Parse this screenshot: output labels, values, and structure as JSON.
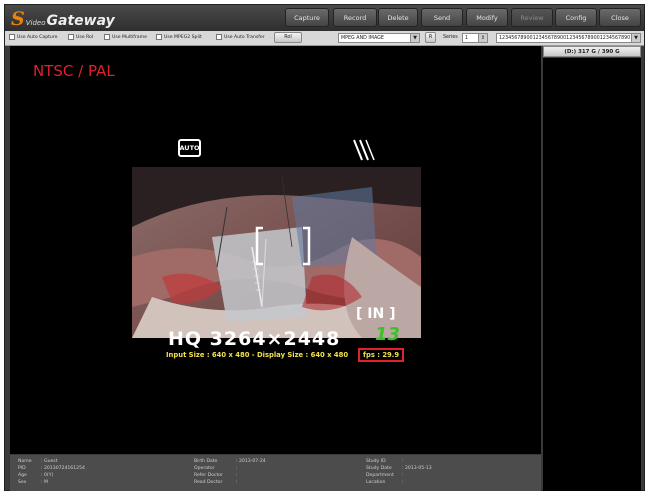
{
  "app": {
    "logo_s": "S",
    "logo_video": "Video",
    "logo_gateway": "Gateway",
    "brand_color": "#e8830f"
  },
  "top_buttons": [
    {
      "label": "Capture",
      "enabled": true
    },
    {
      "label": "Record",
      "enabled": true
    },
    {
      "label": "Delete",
      "enabled": true
    },
    {
      "label": "Send",
      "enabled": true
    },
    {
      "label": "Modify",
      "enabled": true
    },
    {
      "label": "Review",
      "enabled": false
    },
    {
      "label": "Config",
      "enabled": true
    },
    {
      "label": "Close",
      "enabled": true
    }
  ],
  "toolbar": {
    "checkboxes": [
      "Use Auto Capture",
      "Use RoI",
      "Use Multiframe",
      "Use MPEG2 Split",
      "Use Auto Transfer"
    ],
    "roi_button": "RoI",
    "format_select": "MPEG AND IMAGE",
    "r_button": "R",
    "series_label": "Series",
    "series_value": "1",
    "id_select": "1234567890012345678900123456789001234567890"
  },
  "video": {
    "mode_text": "NTSC / PAL",
    "auto_badge": "AUTO",
    "hq_text": "HQ 3264×2448",
    "in_badge": "[ IN ]",
    "frame_counter": "13",
    "input_size_text": "Input Size : 640 x 480 - Display Size : 640 x 480",
    "fps_text": "fps : 29.9",
    "accent_red": "#e0202a",
    "accent_yellow": "#f2e24a"
  },
  "side": {
    "disk_usage": "(D:) 317 G / 390 G"
  },
  "patient": {
    "name_label": "Name",
    "name_value": ": Guest",
    "pid_label": "PID",
    "pid_value": ": 20130724161254",
    "age_label": "Age",
    "age_value": ": 0(Y)",
    "sex_label": "Sex",
    "sex_value": ": M",
    "birth_label": "Birth Date",
    "birth_value": ": 2013-07-24",
    "operator_label": "Operator",
    "operator_value": ":",
    "refer_label": "Refer Doctor",
    "refer_value": ":",
    "read_label": "Read Doctor",
    "read_value": ":",
    "study_id_label": "Study ID",
    "study_id_value": ":",
    "study_date_label": "Study Date",
    "study_date_value": ": 2013-05-13",
    "dept_label": "Department",
    "dept_value": ":",
    "loc_label": "Location",
    "loc_value": ":"
  }
}
